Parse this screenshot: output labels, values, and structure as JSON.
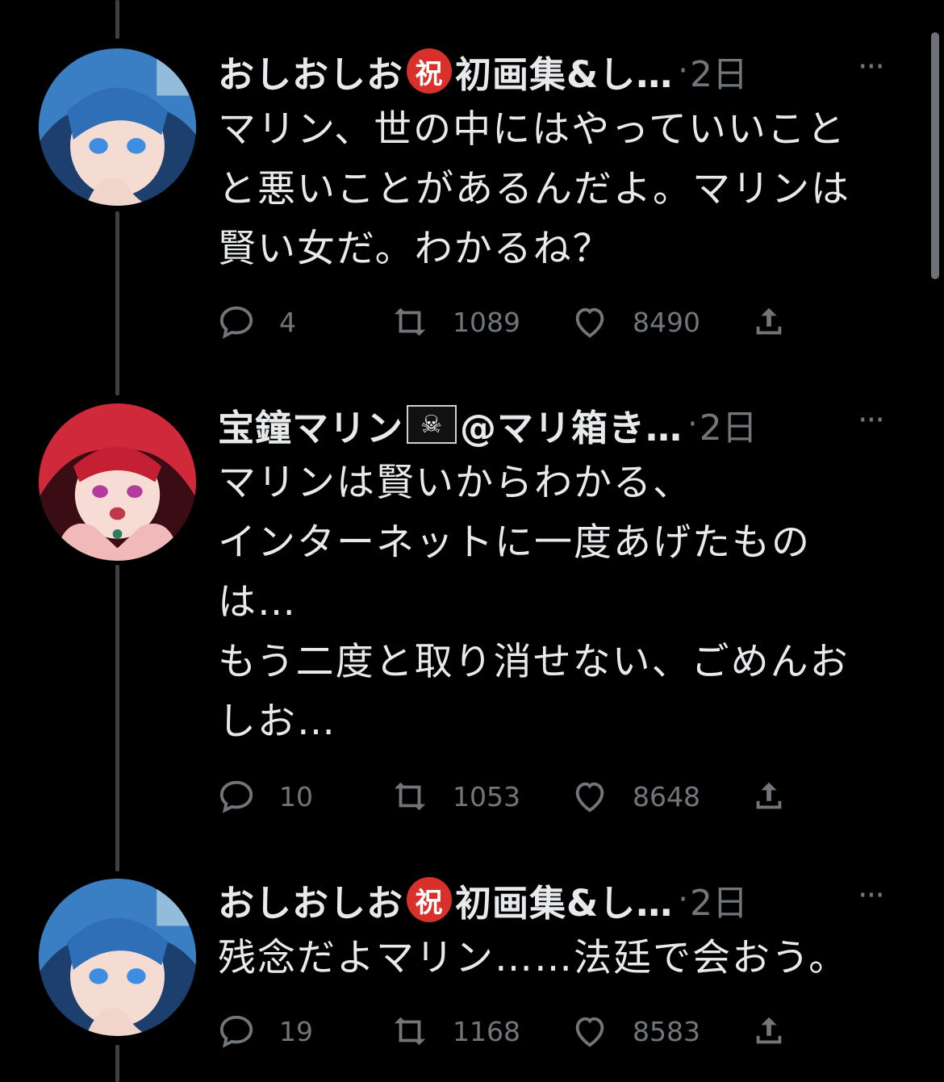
{
  "colors": {
    "background": "#000000",
    "text": "#e7e9ea",
    "muted": "#71767b",
    "badge_red": "#d9302b"
  },
  "tweets": [
    {
      "author": "おしおしお",
      "author_badge": "祝",
      "author_suffix": "初画集&し…",
      "dot": "·",
      "time": "2日",
      "more": "···",
      "text": "マリン、世の中にはやっていいこと\nと悪いことがあるんだよ。マリンは\n賢い女だ。わかるね？",
      "replies": "4",
      "retweets": "1089",
      "likes": "8490",
      "avatar_icon": "blue-hair-avatar"
    },
    {
      "author": "宝鐘マリン",
      "author_badge": "☠",
      "author_suffix": "@マリ箱き…",
      "dot": "·",
      "time": "2日",
      "more": "···",
      "text": "マリンは賢いからわかる、\nインターネットに一度あげたもの\nは…\nもう二度と取り消せない、ごめんお\nしお…",
      "replies": "10",
      "retweets": "1053",
      "likes": "8648",
      "avatar_icon": "red-hair-avatar"
    },
    {
      "author": "おしおしお",
      "author_badge": "祝",
      "author_suffix": "初画集&し…",
      "dot": "·",
      "time": "2日",
      "more": "···",
      "text": "残念だよマリン……法廷で会おう。",
      "replies": "19",
      "retweets": "1168",
      "likes": "8583",
      "avatar_icon": "blue-hair-avatar"
    }
  ]
}
